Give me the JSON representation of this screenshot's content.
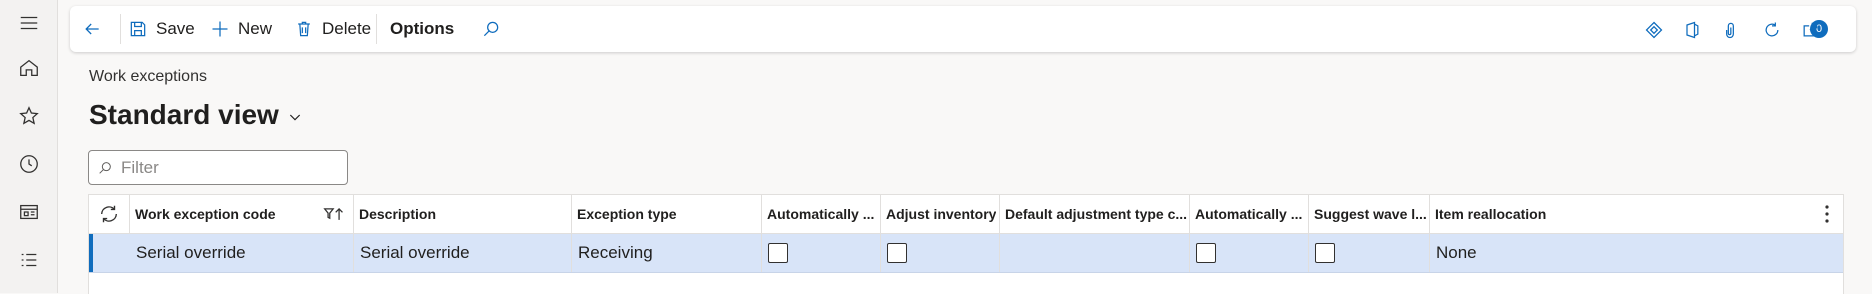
{
  "toolbar": {
    "save_label": "Save",
    "new_label": "New",
    "delete_label": "Delete",
    "options_label": "Options",
    "attachments_count": "0"
  },
  "page": {
    "breadcrumb": "Work exceptions",
    "view_name": "Standard view"
  },
  "filter": {
    "placeholder": "Filter"
  },
  "grid": {
    "columns": [
      "Work exception code",
      "Description",
      "Exception type",
      "Automatically ...",
      "Adjust inventory",
      "Default adjustment type c...",
      "Automatically ...",
      "Suggest wave l...",
      "Item reallocation"
    ],
    "rows": [
      {
        "code": "Serial override",
        "description": "Serial override",
        "exception_type": "Receiving",
        "auto1": false,
        "adjust_inventory": false,
        "default_adjustment_type": "",
        "auto2": false,
        "suggest_wave": false,
        "item_reallocation": "None"
      }
    ]
  },
  "colors": {
    "accent": "#0f6cbd",
    "selected_row": "#d8e4f8",
    "background": "#f9f8f7"
  }
}
